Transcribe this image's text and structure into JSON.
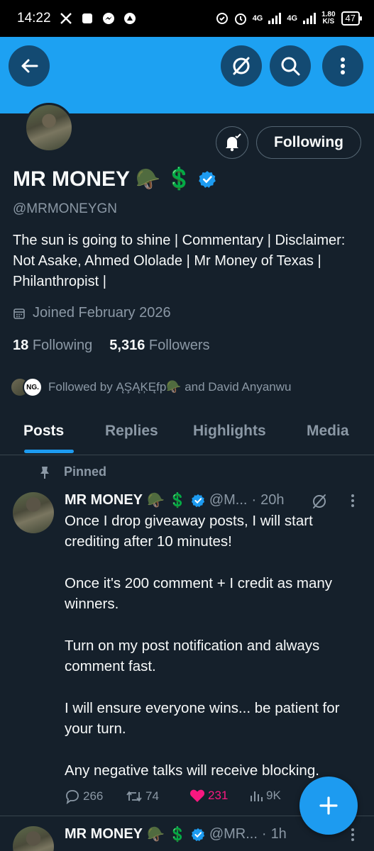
{
  "status_bar": {
    "time": "14:22",
    "network_1": "4G",
    "network_2": "4G",
    "speed_value": "1.80",
    "speed_unit": "K/S",
    "battery": "47"
  },
  "profile": {
    "name": "MR MONEY",
    "name_emoji": "🪖",
    "name_dollar": "💲",
    "handle": "@MRMONEYGN",
    "bio": "The sun is going to shine | Commentary | Disclaimer: Not Asake, Ahmed Ololade | Mr Money of Texas | Philanthropist |",
    "joined": "Joined February 2026",
    "following_count": "18",
    "following_label": "Following",
    "followers_count": "5,316",
    "followers_label": "Followers",
    "followed_by": "Followed by ĄŞĄĶĘfp🪖 and David Anyanwu",
    "mini_avatar_text": "NG.",
    "following_button": "Following"
  },
  "tabs": [
    {
      "label": "Posts",
      "active": true
    },
    {
      "label": "Replies",
      "active": false
    },
    {
      "label": "Highlights",
      "active": false
    },
    {
      "label": "Media",
      "active": false
    }
  ],
  "posts": [
    {
      "pinned_label": "Pinned",
      "name": "MR MONEY",
      "name_emoji": "🪖",
      "name_dollar": "💲",
      "handle": "@M...",
      "time": "20h",
      "paragraphs": [
        "Once I drop giveaway posts, I will start crediting after 10 minutes!",
        "Once it's 200 comment + I credit as many winners.",
        "Turn on my post notification and always comment fast.",
        "I will ensure everyone wins... be patient for your turn.",
        "Any negative talks will receive blocking."
      ],
      "replies": "266",
      "reposts": "74",
      "likes": "231",
      "views": "9K"
    },
    {
      "name": "MR MONEY",
      "name_emoji": "🪖",
      "name_dollar": "💲",
      "handle": "@MR...",
      "time": "1h"
    }
  ],
  "icons": {
    "back": "arrow-left-icon",
    "grok": "grok-icon",
    "search": "search-icon",
    "more": "more-vertical-icon",
    "notify": "bell-check-icon",
    "calendar": "calendar-icon",
    "pin": "pin-icon",
    "verified": "verified-badge-icon",
    "compose": "plus-icon"
  },
  "colors": {
    "background": "#15202b",
    "banner": "#1da1f2",
    "accent": "#1d9bf0",
    "muted": "#8b98a5",
    "like": "#f91880"
  }
}
